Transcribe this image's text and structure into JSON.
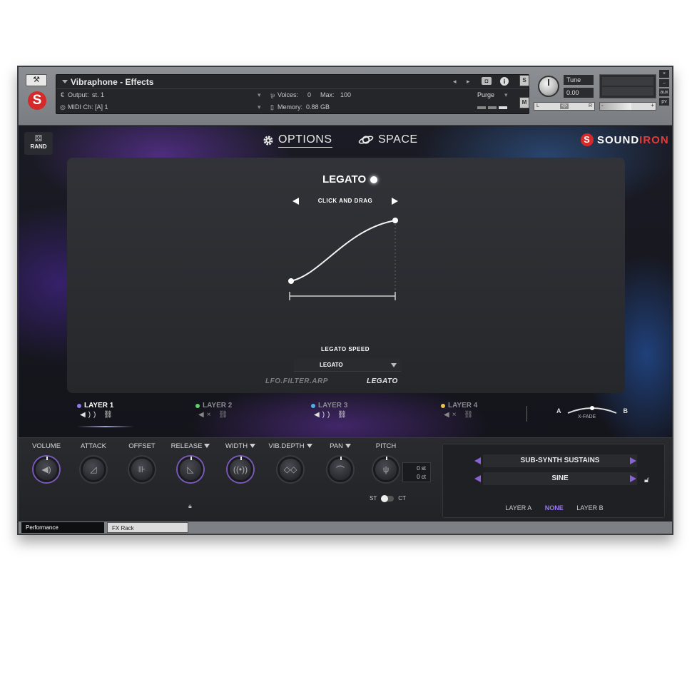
{
  "header": {
    "instrument_name": "Vibraphone - Effects",
    "output_label": "Output:",
    "output_value": "st. 1",
    "voices_label": "Voices:",
    "voices_value": "0",
    "max_label": "Max:",
    "max_value": "100",
    "purge_label": "Purge",
    "midi_label": "MIDI Ch:",
    "midi_value": "[A]  1",
    "memory_label": "Memory:",
    "memory_value": "0.88 GB",
    "solo_label": "S",
    "mute_label": "M",
    "tune_label": "Tune",
    "tune_value": "0.00",
    "pan_left": "L",
    "pan_right": "R",
    "pan_center": "<|>",
    "vol_minus": "-",
    "vol_plus": "+",
    "side_buttons": [
      "×",
      "–",
      "aux",
      "pv"
    ]
  },
  "stage": {
    "rand_label": "RAND",
    "tabs": [
      {
        "label": "OPTIONS",
        "active": true
      },
      {
        "label": "SPACE",
        "active": false
      }
    ],
    "brand_white": "SOUND",
    "brand_red": "IRON",
    "options": {
      "title": "LEGATO",
      "drag_hint": "CLICK AND DRAG",
      "speed_label": "LEGATO SPEED",
      "speed_value": "LEGATO",
      "subtabs": [
        {
          "label": "LFO.FILTER.ARP",
          "active": false
        },
        {
          "label": "LEGATO",
          "active": true
        }
      ]
    },
    "layers": [
      {
        "label": "LAYER 1",
        "color": "#8f7ae8",
        "active": true
      },
      {
        "label": "LAYER 2",
        "color": "#5fd06a",
        "active": false
      },
      {
        "label": "LAYER 3",
        "color": "#4fb0e8",
        "active": true
      },
      {
        "label": "LAYER 4",
        "color": "#e8c24f",
        "active": false
      }
    ],
    "xfade": {
      "a": "A",
      "b": "B",
      "label": "X-FADE"
    }
  },
  "controls": {
    "knobs": [
      {
        "label": "VOLUME",
        "icon": "speaker-icon",
        "dropdown": false
      },
      {
        "label": "ATTACK",
        "icon": "attack-ramp-icon",
        "dropdown": false
      },
      {
        "label": "OFFSET",
        "icon": "offset-icon",
        "dropdown": false
      },
      {
        "label": "RELEASE",
        "icon": "release-ramp-icon",
        "dropdown": true
      },
      {
        "label": "WIDTH",
        "icon": "stereo-width-icon",
        "dropdown": true
      },
      {
        "label": "VIB.DEPTH",
        "icon": "vibrato-icon",
        "dropdown": true
      },
      {
        "label": "PAN",
        "icon": "pan-arc-icon",
        "dropdown": true
      },
      {
        "label": "PITCH",
        "icon": "tuning-fork-icon",
        "dropdown": false
      }
    ],
    "pitch_st": "0 st",
    "pitch_ct": "0 ct",
    "st_label": "ST",
    "ct_label": "CT",
    "preset": {
      "row1": "SUB-SYNTH SUSTAINS",
      "row2": "SINE",
      "layer_a": "LAYER A",
      "none": "NONE",
      "layer_b": "LAYER B"
    }
  },
  "bottom_tabs": [
    {
      "label": "Performance",
      "active": true
    },
    {
      "label": "FX Rack",
      "active": false
    }
  ],
  "colors": {
    "accent_purple": "#8a62d8",
    "brand_red": "#d42a2a"
  }
}
